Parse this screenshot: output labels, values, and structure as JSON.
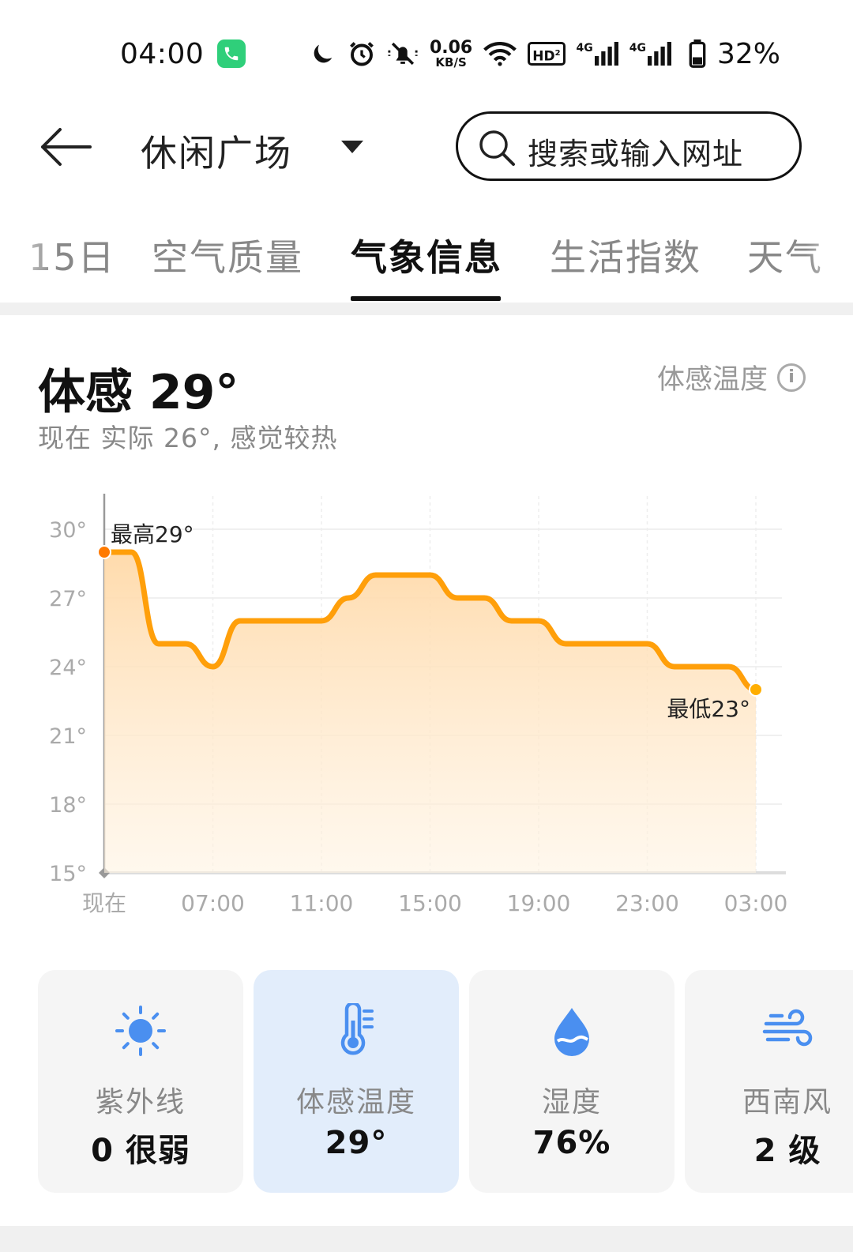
{
  "status": {
    "time": "04:00",
    "net_speed_value": "0.06",
    "net_speed_unit": "KB/S",
    "hd_label": "HD",
    "network_1": "4G",
    "network_2": "4G",
    "battery": "32%"
  },
  "header": {
    "location": "休闲广场",
    "search_placeholder": "搜索或输入网址"
  },
  "tabs": [
    {
      "label": "15日"
    },
    {
      "label": "空气质量"
    },
    {
      "label": "气象信息"
    },
    {
      "label": "生活指数"
    },
    {
      "label": "天气"
    }
  ],
  "feel": {
    "title": "体感 29°",
    "subtitle": "现在 实际 26°, 感觉较热",
    "link": "体感温度",
    "info_glyph": "i"
  },
  "chart_data": {
    "type": "area",
    "y_ticks": [
      "30°",
      "27°",
      "24°",
      "21°",
      "18°",
      "15°"
    ],
    "ylim": [
      15,
      30
    ],
    "x_ticks": [
      "现在",
      "07:00",
      "11:00",
      "15:00",
      "19:00",
      "23:00",
      "03:00"
    ],
    "x_hours": [
      0,
      1,
      2,
      3,
      4,
      5,
      6,
      7,
      8,
      9,
      10,
      11,
      12,
      13,
      14,
      15,
      16,
      17,
      18,
      19,
      20,
      21,
      22,
      23,
      24
    ],
    "series": [
      {
        "values": [
          29,
          29,
          25,
          25,
          24,
          26,
          26,
          26,
          26,
          27,
          28,
          28,
          28,
          27,
          27,
          26,
          26,
          25,
          25,
          25,
          25,
          24,
          24,
          24,
          23
        ],
        "color": "#ff9f0a"
      }
    ],
    "max_label": "最高29°",
    "min_label": "最低23°",
    "grid": true
  },
  "cards": [
    {
      "icon": "sun-icon",
      "label": "紫外线",
      "value": "0 很弱"
    },
    {
      "icon": "thermometer-icon",
      "label": "体感温度",
      "value": "29°"
    },
    {
      "icon": "water-drop-icon",
      "label": "湿度",
      "value": "76%"
    },
    {
      "icon": "wind-icon",
      "label": "西南风",
      "value": "2 级"
    }
  ],
  "colors": {
    "accent": "#ff9f0a",
    "active_card": "#e2edfb",
    "icon_blue": "#4a8ff0"
  }
}
